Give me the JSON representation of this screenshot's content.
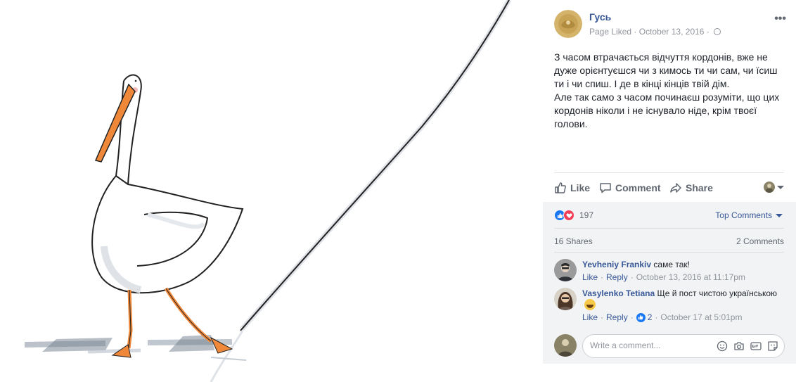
{
  "post": {
    "page_name": "Гусь",
    "meta_liked": "Page Liked",
    "meta_sep": "·",
    "date": "October 13, 2016",
    "text": "З часом втрачається відчуття кордонів, вже не дуже орієнтуєшся чи з кимось ти чи сам, чи їсиш ти і чи спиш. І де в кінці кінців твій дім.\nАле так само з часом починаєш розуміти, що цих кордонів ніколи і не існувало ніде, крім твоєї голови."
  },
  "actions": {
    "like": "Like",
    "comment": "Comment",
    "share": "Share"
  },
  "stats": {
    "reactions": "197",
    "sort": "Top Comments",
    "shares": "16 Shares",
    "comments": "2 Comments"
  },
  "comments": [
    {
      "author": "Yevheniy Frankiv",
      "text": "саме так!",
      "like": "Like",
      "reply": "Reply",
      "time": "October 13, 2016 at 11:17pm"
    },
    {
      "author": "Vasylenko Tetiana",
      "text": "Ще й пост чистою українською",
      "like": "Like",
      "reply": "Reply",
      "likes": "2",
      "time": "October 17 at 5:01pm"
    }
  ],
  "composer": {
    "placeholder": "Write a comment..."
  },
  "icons": {
    "more": "more-options-icon",
    "privacy": "globe-icon",
    "like": "thumbs-up-icon",
    "comment": "speech-bubble-icon",
    "share": "share-arrow-icon",
    "emoji": "smiley-icon",
    "camera": "camera-icon",
    "gif": "gif-icon",
    "sticker": "sticker-icon"
  },
  "colors": {
    "link": "#385898",
    "like_blue": "#1877f2",
    "love_red": "#f33e58",
    "beak_orange": "#f0883a",
    "comments_bg": "#f2f3f5"
  }
}
